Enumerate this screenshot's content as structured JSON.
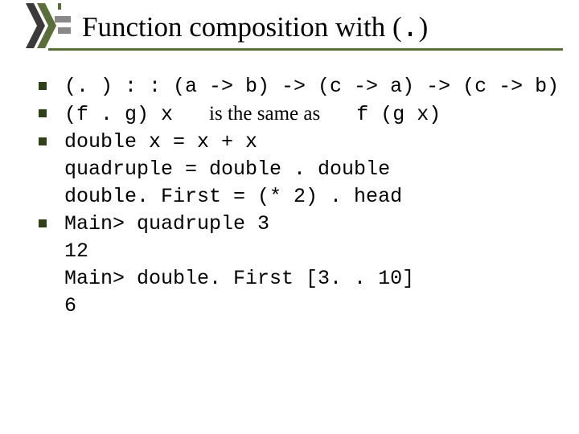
{
  "title": {
    "prefix": "Function composition with (",
    "dot": ".",
    "suffix": ")"
  },
  "bullets": [
    {
      "lines": [
        {
          "segments": [
            {
              "text": "(. ) : : (a -> b) -> (c -> a) -> (c -> b)",
              "style": "mono"
            }
          ]
        }
      ]
    },
    {
      "lines": [
        {
          "segments": [
            {
              "text": "(f . g) x   ",
              "style": "mono"
            },
            {
              "text": "is the same as",
              "style": "serif"
            },
            {
              "text": "   f (g x)",
              "style": "mono"
            }
          ]
        }
      ]
    },
    {
      "lines": [
        {
          "segments": [
            {
              "text": "double x = x + x",
              "style": "mono"
            }
          ]
        },
        {
          "segments": [
            {
              "text": "quadruple = double . double",
              "style": "mono"
            }
          ]
        },
        {
          "segments": [
            {
              "text": "double. First = (* 2) . head",
              "style": "mono"
            }
          ]
        }
      ]
    },
    {
      "lines": [
        {
          "segments": [
            {
              "text": "Main> quadruple 3",
              "style": "mono"
            }
          ]
        },
        {
          "segments": [
            {
              "text": "12",
              "style": "mono"
            }
          ]
        },
        {
          "segments": [
            {
              "text": "Main> double. First [3. . 10]",
              "style": "mono"
            }
          ]
        },
        {
          "segments": [
            {
              "text": "6",
              "style": "mono"
            }
          ]
        }
      ]
    }
  ],
  "colors": {
    "accent": "#5a6e3a",
    "bullet": "#2f4017"
  }
}
